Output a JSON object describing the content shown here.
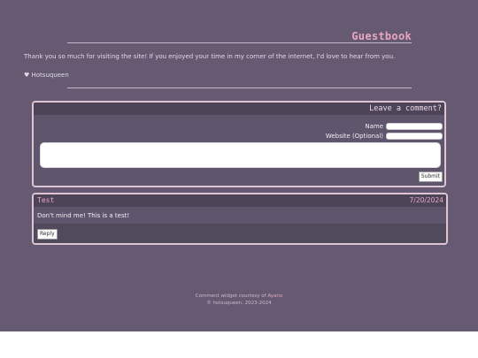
{
  "guestbook": {
    "title": "Guestbook",
    "intro": "Thank you so much for visiting the site! If you enjoyed your time in my corner of the internet, I'd love to hear from you.",
    "signature": "♥ Hotsuqueen"
  },
  "form": {
    "header": "Leave a comment?",
    "name_label": "Name",
    "website_label": "Website (Optional)",
    "name_value": "",
    "website_value": "",
    "comment_value": "",
    "submit_label": "Submit"
  },
  "comments": [
    {
      "name": "Test",
      "date": "7/20/2024",
      "text": "Don't mind me! This is a test!",
      "reply_label": "Reply"
    }
  ],
  "footer": {
    "line1_prefix": "Comment widget courtesy of ",
    "line1_link": "Ayano",
    "line2": "© hotsuqueen, 2023-2024"
  },
  "colors": {
    "background": "#655a72",
    "accent": "#e9a6c0",
    "header_band": "#4d4457"
  }
}
